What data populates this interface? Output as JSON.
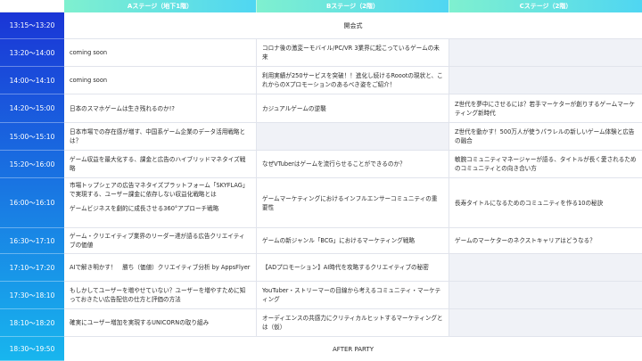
{
  "stages": [
    {
      "name": "Aステージ（地下1階）"
    },
    {
      "name": "Bステージ（2階）"
    },
    {
      "name": "Cステージ（2階）"
    }
  ],
  "colors": {
    "header_gradient": [
      "#7ff0cf",
      "#4fd6f2"
    ],
    "time_gradient_top": "#1a35d6",
    "time_gradient_bottom": "#18b6ee",
    "empty_cell": "#f0f2f7"
  },
  "rows": [
    {
      "time": "13:15〜13:20",
      "span": "開会式"
    },
    {
      "time": "13:20〜14:00",
      "a": "coming soon",
      "b": "コロナ後の激変ーモバイル/PC/VR 3業界に起こっているゲームの未来",
      "c": ""
    },
    {
      "time": "14:00〜14:10",
      "a": "coming soon",
      "b": "利用実績が250サービスを突破！！進化し続けるRoootの現状と、これからのXプロモーションのあるべき姿をご紹介！",
      "c": ""
    },
    {
      "time": "14:20〜15:00",
      "a": "日本のスマホゲームは生き残れるのか!?",
      "b": "カジュアルゲームの逆襲",
      "c": "Z世代を夢中にさせるには？若手マーケターが創りするゲームマーケティング新時代"
    },
    {
      "time": "15:00〜15:10",
      "a": "日本市場での存在感が増す、中国系ゲーム企業のデータ活用戦略とは？",
      "b": "",
      "c": "Z世代を動かす！500万人が使うパラレルの新しいゲーム体験と広告の融合"
    },
    {
      "time": "15:20〜16:00",
      "a": "ゲーム収益を最大化する、課金と広告のハイブリッドマネタイズ戦略",
      "b": "なぜVTuberはゲームを流行らせることができるのか？",
      "c": "敏腕コミュニティマネージャーが語る、タイトルが長く愛されるためのコミュニティとの向き合い方"
    },
    {
      "time": "16:00〜16:10",
      "a_lines": [
        "市場トップシェアの広告マネタイズプラットフォーム「SKYFLAG」で実現する、ユーザー課金に依存しない収益化戦略とは",
        "ゲームビジネスを劇的に成長させる360°アプローチ戦略"
      ],
      "b": "ゲームマーケティングにおけるインフルエンサーコミュニティの重要性",
      "c": "長寿タイトルになるためのコミュニティを作る10の秘訣"
    },
    {
      "time": "16:30〜17:10",
      "a": "ゲーム・クリエイティブ業界のリーダー達が語る広告クリエイティブの価値",
      "b": "ゲームの新ジャンル「BCG」におけるマーケティング戦略",
      "c": "ゲームのマーケターのネクストキャリアはどうなる？"
    },
    {
      "time": "17:10〜17:20",
      "a": "AIで解き明かす！　勝ち（価値）クリエイティブ分析 by AppsFlyer",
      "b": "【ADプロモーション】AI時代を攻略するクリエイティブの秘密",
      "c": ""
    },
    {
      "time": "17:30〜18:10",
      "a": "もしかしてユーザーを増やせていない？ユーザーを増やすために知っておきたい広告配信の仕方と評価の方法",
      "b": "YouTuber・ストリーマーの目線から考えるコミュニティ・マーケティング",
      "c": ""
    },
    {
      "time": "18:10〜18:20",
      "a": "確実にユーザー増加を実現するUNICORNの取り組み",
      "b": "オーディエンスの共感力にクリティカルヒットするマーケティングとは（仮）",
      "c": ""
    },
    {
      "time": "18:30〜19:50",
      "span": "AFTER PARTY"
    }
  ]
}
